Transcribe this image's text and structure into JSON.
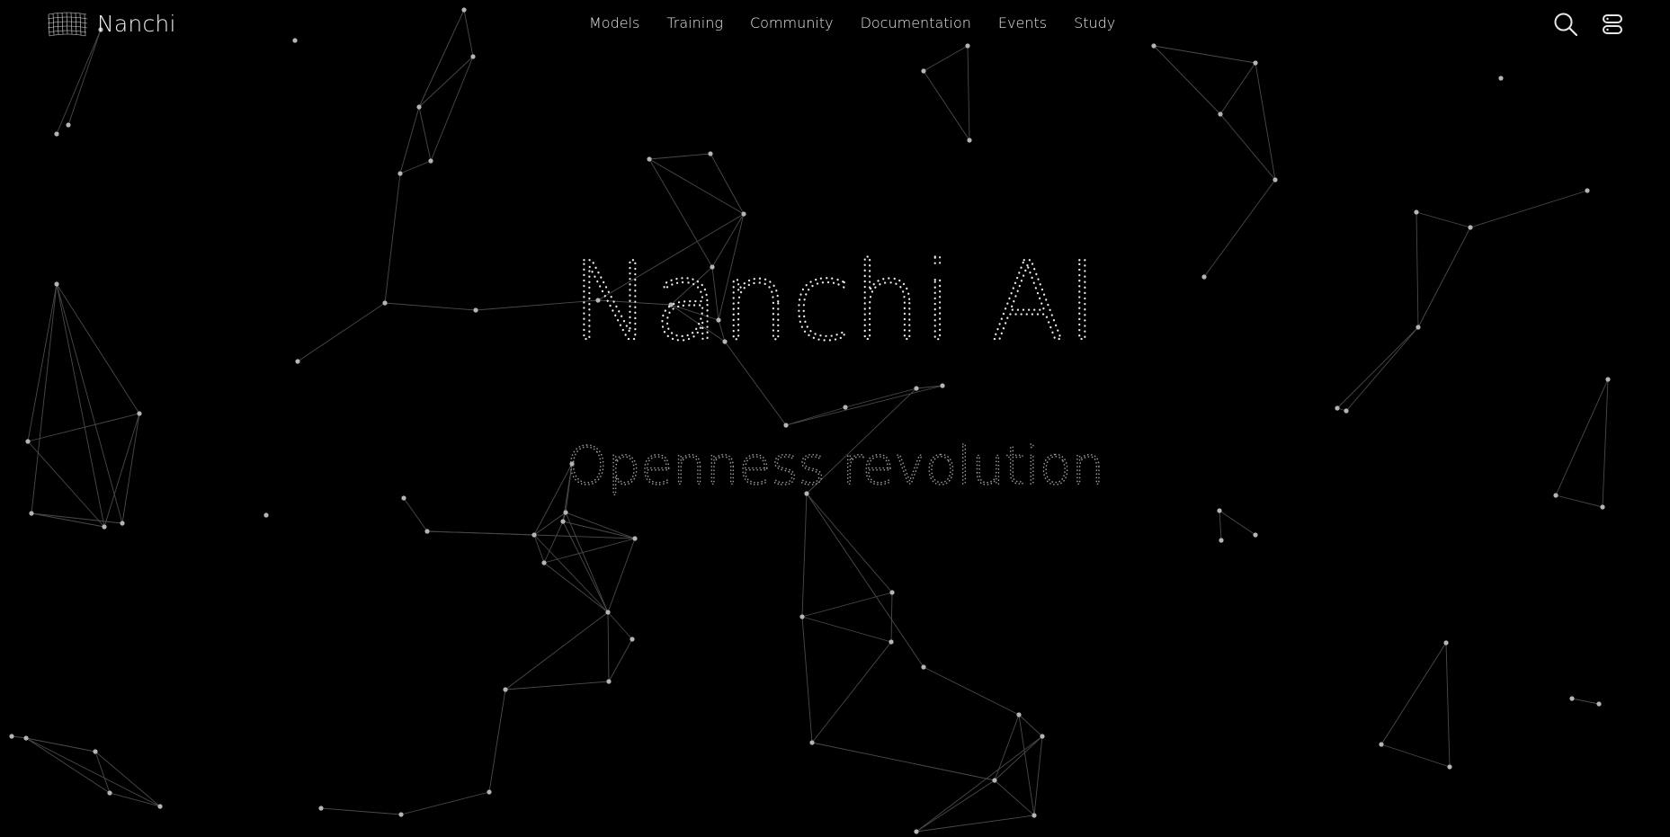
{
  "brand": {
    "name": "Nanchi",
    "logo_icon": "mesh-logo-icon"
  },
  "nav": {
    "items": [
      {
        "label": "Models"
      },
      {
        "label": "Training"
      },
      {
        "label": "Community"
      },
      {
        "label": "Documentation"
      },
      {
        "label": "Events"
      },
      {
        "label": "Study"
      }
    ]
  },
  "actions": {
    "search_icon": "search-icon",
    "menu_icon": "menu-toggle-icon"
  },
  "hero": {
    "title": "Nanchi AI",
    "subtitle": "Openness revolution"
  },
  "colors": {
    "background": "#000000",
    "text": "#e6e6e6",
    "network_line": "#5a5a5a",
    "network_node": "#bdbdbd"
  }
}
